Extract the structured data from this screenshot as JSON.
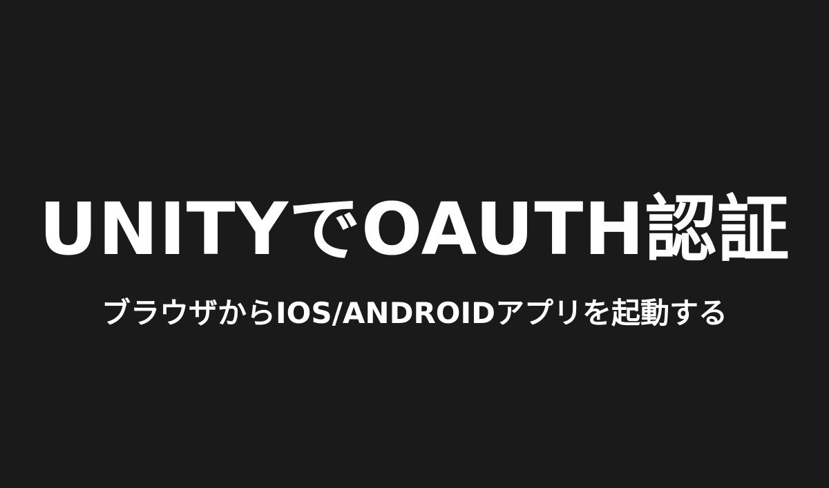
{
  "title": "UNITYでOAUTH認証",
  "subtitle": "ブラウザからIOS/ANDROIDアプリを起動する",
  "colors": {
    "background": "#1a1a1a",
    "text": "#ffffff"
  }
}
